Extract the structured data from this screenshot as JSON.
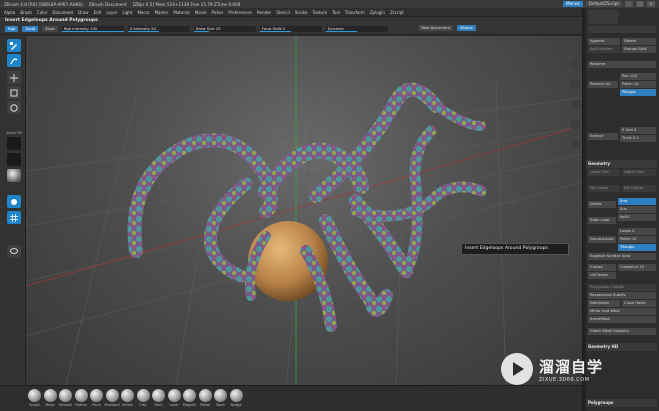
{
  "title_bar": {
    "app": "ZBrush 4.8 [R6] [SN0L6P-APK7-AHK6]",
    "document": "ZBrush Document",
    "stats": "[ZBpr 6.5] Mem 514+1139  Free 15.79  ZTime 0.004",
    "menus_btn": "Menus",
    "script_btn": "DefaultZScript"
  },
  "menu_bar": [
    "Alpha",
    "Brush",
    "Color",
    "Document",
    "Draw",
    "Edit",
    "Layer",
    "Light",
    "Macro",
    "Marker",
    "Material",
    "Movie",
    "Picker",
    "Preferences",
    "Render",
    "Stencil",
    "Stroke",
    "Texture",
    "Tool",
    "Transform",
    "Zplugin",
    "Zscript"
  ],
  "toolbar": {
    "hint": "Insert Edgeloops Around Polygroups",
    "buttons": [
      {
        "label": "Rgb",
        "on": true
      },
      {
        "label": "Zadd",
        "on": true
      },
      {
        "label": "Zsub",
        "on": false
      }
    ],
    "sliders": [
      {
        "label": "Rgb Intensity 100",
        "fill": 1.0
      },
      {
        "label": "Z Intensity 50",
        "fill": 0.5
      },
      {
        "label": "Draw Size 25",
        "fill": 0.25
      },
      {
        "label": "Focal Shift 0",
        "fill": 0.5
      },
      {
        "label": "Dynamic",
        "fill": 0.5
      }
    ],
    "right_buttons": [
      {
        "label": "New Document",
        "on": false
      },
      {
        "label": "Wsave",
        "on": true
      }
    ]
  },
  "left_shelf": {
    "tools": [
      {
        "name": "edit-icon",
        "on": true
      },
      {
        "name": "draw-icon",
        "on": true
      },
      {
        "name": "move-icon",
        "on": false
      },
      {
        "name": "scale-icon",
        "on": false
      },
      {
        "name": "rotate-icon",
        "on": false
      }
    ],
    "labels": [
      "Alpha Off",
      "Texture Off",
      "Material"
    ]
  },
  "viewport": {
    "tooltip": "Insert Edgeloops Around Polygroups"
  },
  "right_panel": {
    "append": "Append",
    "delete": "Delete",
    "split": "Split Hidden",
    "groups_split": "Groups Split",
    "rename": "Rename",
    "remesh_all": "Remesh All",
    "res": "Res 128",
    "polish": "Polish 10",
    "polygrp": "Polygrp",
    "extract": "Extract",
    "smt": "S Smt 5",
    "thick": "Thick 0.1",
    "section_geometry": "Geometry",
    "lower_res": "Lower Res",
    "higher_res": "Higher Res",
    "del_lower": "Del Lower",
    "del_higher": "Del Higher",
    "divide": "Divide",
    "smt_on": "Smt",
    "suv": "Suv",
    "reuv": "ReUV",
    "edge_loop": "Edge Loop",
    "groups_loops": "GroupsLoops",
    "loops": "Loops 4",
    "polish2": "Polish 10",
    "triangle": "Triangle",
    "equalize": "Equalize Surface Area",
    "crease": "Crease",
    "crease_lvl": "CreaseLvl 15",
    "uncrease": "UnCrease",
    "polygroups_subdiv": "Polygroups Subdiv",
    "reconstruct": "Reconstruct Subdiv",
    "del_hidden": "DelHidden",
    "close_holes": "Close Holes",
    "mirror_weld": "Mirror And Weld",
    "insert_mesh": "InsertMesh",
    "check_mesh": "Check Mesh Integrity",
    "section_geometry_hd": "Geometry HD",
    "section_polygroups": "Polygroups"
  },
  "bottom_shelf": {
    "brushes": [
      "Sculpt",
      "Move",
      "Smooth",
      "Flatten",
      "Pinch",
      "Standard",
      "Inflate",
      "Clay",
      "Dam",
      "Layer",
      "Magnify",
      "Planar",
      "Slash",
      "Nudge"
    ]
  },
  "watermark": {
    "cn": "溜溜自学",
    "url": "ZIXUE.3D66.COM"
  }
}
